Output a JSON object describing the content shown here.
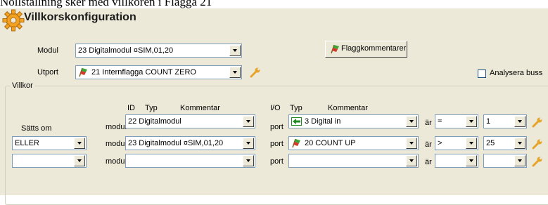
{
  "caption": "Nollställning sker med villkoren i Flagga 21",
  "window": {
    "title": "Villkorskonfiguration"
  },
  "modul": {
    "label": "Modul",
    "value": "23 Digitalmodul  ¤SIM,01,20"
  },
  "flag_button": {
    "label": "Flaggkommentarer"
  },
  "utport": {
    "label": "Utport",
    "value": "21 Internflagga COUNT ZERO"
  },
  "analyze": {
    "label": "Analysera buss",
    "checked": false
  },
  "group": {
    "legend": "Villkor"
  },
  "headers": {
    "id": "ID",
    "type": "Typ",
    "comment": "Kommentar",
    "io": "I/O",
    "type2": "Typ",
    "comment2": "Kommentar"
  },
  "condition_label": "Sätts om",
  "rows": [
    {
      "logic": "",
      "modul_label": "modul",
      "modul_value": "22 Digitalmodul",
      "port_label": "port",
      "port_value": "3  Digital in",
      "is_label": "är",
      "op": "=",
      "val": "1"
    },
    {
      "logic": "ELLER",
      "modul_label": "modul",
      "modul_value": "23 Digitalmodul  ¤SIM,01,20",
      "port_label": "port",
      "port_value": "20 COUNT UP",
      "is_label": "är",
      "op": ">",
      "val": "25"
    },
    {
      "logic": "",
      "modul_label": "modul",
      "modul_value": "",
      "port_label": "port",
      "port_value": "",
      "is_label": "är",
      "op": "",
      "val": ""
    }
  ],
  "colors": {
    "panel": "#ece9d8",
    "field_border": "#7f9db9",
    "input_arrow_green": "#1f8a1f",
    "flag_green": "#3da536",
    "flag_red": "#d43a2a",
    "wrench": "#e6a42a"
  }
}
